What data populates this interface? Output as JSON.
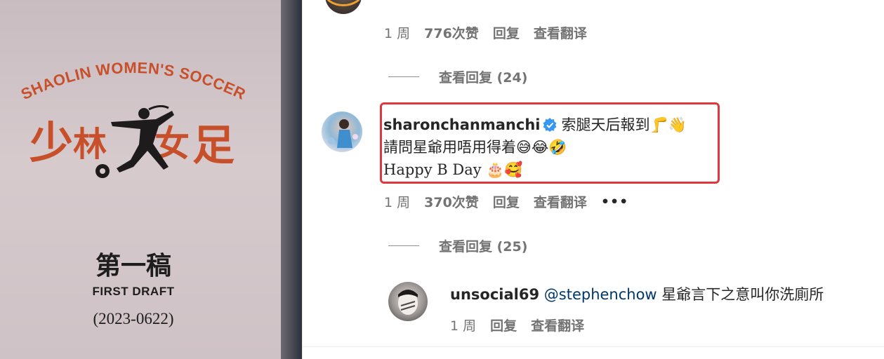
{
  "poster": {
    "arc_text": "SHAOLIN WOMEN'S SOCCER",
    "cn_logo": "少林女足",
    "draft_cn": "第一稿",
    "draft_en": "FIRST DRAFT",
    "draft_date": "(2023-0622)"
  },
  "top_comment_meta": {
    "time": "1 周",
    "likes": "776次赞",
    "reply": "回复",
    "translate": "查看翻译"
  },
  "view_replies_1": {
    "label": "查看回复 (24)"
  },
  "highlight_comment": {
    "username": "sharonchanmanchi",
    "verified": true,
    "line1": "索腿天后報到",
    "line1_emojis": "🦵👋",
    "line2": "請問星爺用唔用得着",
    "line2_emojis": "😅😂🤣",
    "line3": "𝕳𝖆𝖕𝖕𝖞 𝔹 𝔻𝕒𝕪",
    "line3_display": "Happy B Day",
    "line3_emojis": "🎂🥰",
    "time": "1 周",
    "likes": "370次赞",
    "reply": "回复",
    "translate": "查看翻译",
    "more": "•••"
  },
  "view_replies_2": {
    "label": "查看回复 (25)"
  },
  "reply_comment": {
    "username": "unsocial69",
    "mention": "@stephenchow",
    "text": "星爺言下之意叫你洗廁所",
    "time": "1 周",
    "reply": "回复",
    "translate": "查看翻译"
  },
  "colors": {
    "highlight_border": "#e0383f",
    "verified_blue": "#3897f0",
    "mention": "#00376b",
    "muted": "#737373",
    "text": "#262626",
    "poster_red": "#c7502a"
  }
}
